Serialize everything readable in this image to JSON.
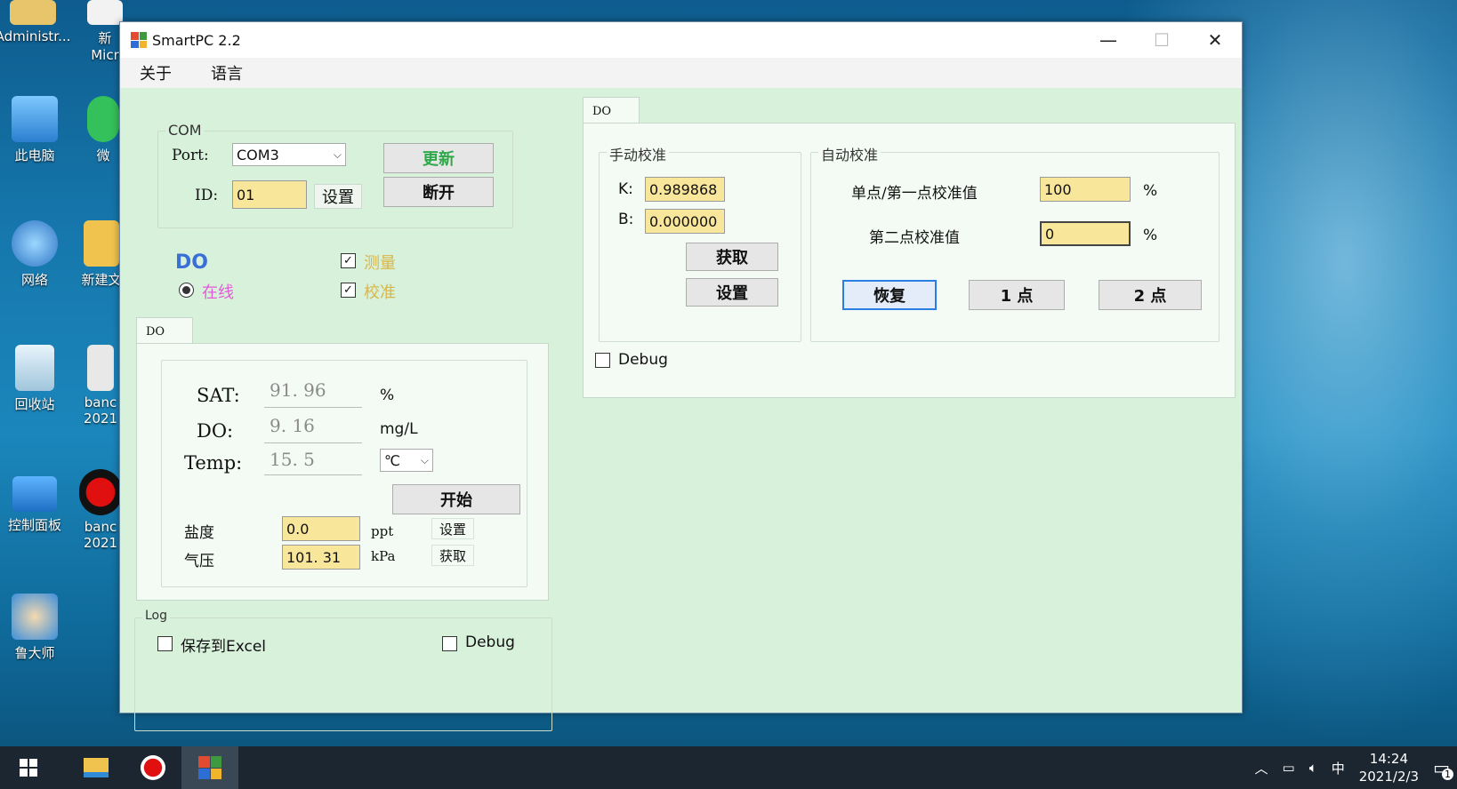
{
  "desktop": {
    "icons": [
      {
        "label": "Administr..."
      },
      {
        "label": "新\nMicr"
      },
      {
        "label": "此电脑"
      },
      {
        "label": "微"
      },
      {
        "label": "网络"
      },
      {
        "label": "新建文"
      },
      {
        "label": "回收站"
      },
      {
        "label": "banc\n2021"
      },
      {
        "label": "控制面板"
      },
      {
        "label": "banc\n2021"
      },
      {
        "label": "鲁大师"
      }
    ]
  },
  "window": {
    "title": "SmartPC 2.2",
    "minimize": "—",
    "maximize": "☐",
    "close": "✕"
  },
  "menu": {
    "about": "关于",
    "language": "语言"
  },
  "com": {
    "group_title": "COM",
    "port_label": "Port:",
    "port_value": "COM3",
    "id_label": "ID:",
    "id_value": "01",
    "set_btn": "设置",
    "update_btn": "更新",
    "disconnect_btn": "断开"
  },
  "status": {
    "do_label": "DO",
    "online_label": "在线",
    "measure_label": "测量",
    "calibrate_label": "校准",
    "measure_checked": true,
    "calibrate_checked": true
  },
  "measure_panel": {
    "tab": "DO",
    "sat_label": "SAT:",
    "sat_value": "91. 96",
    "sat_unit": "%",
    "do_label": "DO:",
    "do_value": "9. 16",
    "do_unit": "mg/L",
    "temp_label": "Temp:",
    "temp_value": "15. 5",
    "temp_unit": "℃",
    "start_btn": "开始",
    "salinity_label": "盐度",
    "salinity_value": "0.0",
    "salinity_unit": "ppt",
    "salinity_set": "设置",
    "pressure_label": "气压",
    "pressure_value": "101. 31",
    "pressure_unit": "kPa",
    "pressure_get": "获取"
  },
  "log": {
    "group_title": "Log",
    "save_excel": "保存到Excel",
    "debug": "Debug"
  },
  "calib_panel": {
    "tab": "DO",
    "manual": {
      "group_title": "手动校准",
      "k_label": "K:",
      "k_value": "0.989868",
      "b_label": "B:",
      "b_value": "0.000000",
      "get_btn": "获取",
      "set_btn": "设置"
    },
    "auto": {
      "group_title": "自动校准",
      "first_label": "单点/第一点校准值",
      "first_value": "100",
      "first_unit": "%",
      "second_label": "第二点校准值",
      "second_value": "0",
      "second_unit": "%",
      "restore_btn": "恢复",
      "one_point_btn": "1 点",
      "two_point_btn": "2 点"
    },
    "debug": "Debug"
  },
  "taskbar": {
    "tray_ime": "中",
    "time": "14:24",
    "date": "2021/2/3",
    "notification_count": "1"
  }
}
